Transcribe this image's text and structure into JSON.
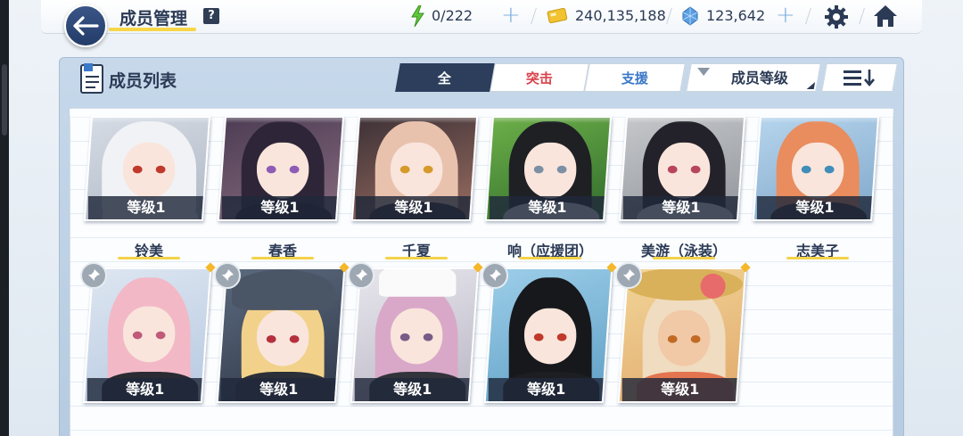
{
  "header": {
    "title": "成员管理",
    "help": "?",
    "ap": "0/222",
    "credits": "240,135,188",
    "gems": "123,642"
  },
  "panel": {
    "title": "成员列表",
    "tabs": [
      {
        "label": "全",
        "selected": true
      },
      {
        "label": "突击",
        "selected": false
      },
      {
        "label": "支援",
        "selected": false
      }
    ],
    "sort_label": "成员等级"
  },
  "members": [
    {
      "name": "铃美",
      "level": "等级1"
    },
    {
      "name": "春香",
      "level": "等级1"
    },
    {
      "name": "千夏",
      "level": "等级1"
    },
    {
      "name": "响（应援团）",
      "level": "等级1"
    },
    {
      "name": "美游（泳装）",
      "level": "等级1"
    },
    {
      "name": "志美子",
      "level": "等级1"
    },
    {
      "name": "",
      "level": "等级1"
    },
    {
      "name": "",
      "level": "等级1"
    },
    {
      "name": "",
      "level": "等级1"
    },
    {
      "name": "",
      "level": "等级1"
    },
    {
      "name": "",
      "level": "等级1"
    }
  ],
  "colors": {
    "accent_navy": "#2c3e5c",
    "strike_red": "#d9414b",
    "support_blue": "#3a78c8",
    "highlight_yellow": "#f5d34a"
  }
}
